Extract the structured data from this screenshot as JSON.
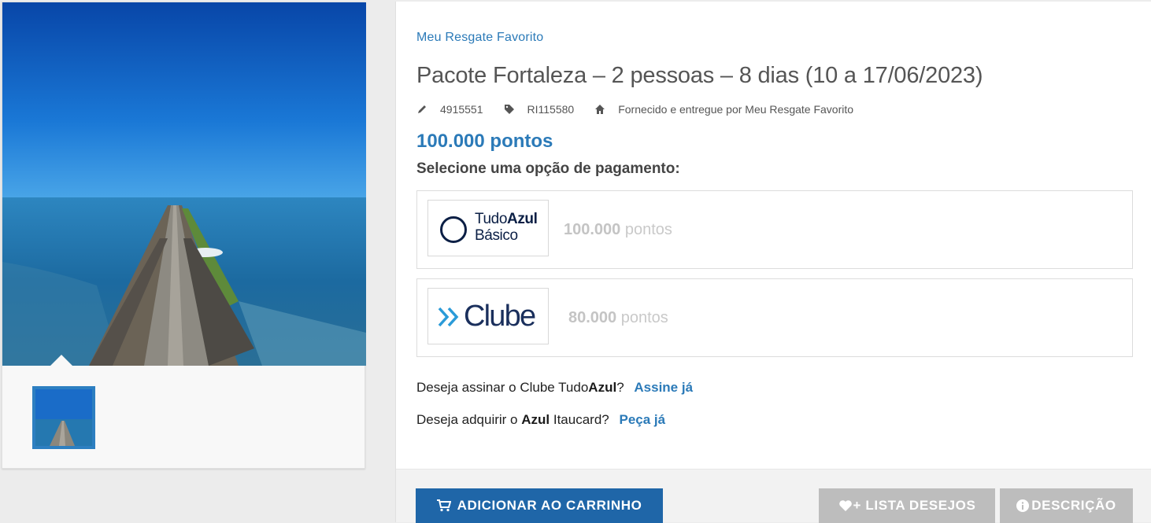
{
  "gallery": {
    "main_image": "fortaleza-pier-aerial-photo",
    "thumbnail": "fortaleza-pier-thumbnail"
  },
  "product": {
    "brand": "Meu Resgate Favorito",
    "title": "Pacote Fortaleza – 2 pessoas – 8 dias (10 a 17/06/2023)",
    "sku": "4915551",
    "ref": "RI115580",
    "supplier": "Fornecido e entregue por Meu Resgate Favorito",
    "price": "100.000 pontos"
  },
  "payment": {
    "label": "Selecione uma opção de pagamento:",
    "options": [
      {
        "logo_text_a": "Tudo",
        "logo_text_b": "Azul",
        "logo_text_c": "Básico",
        "points": "100.000",
        "unit": "pontos"
      },
      {
        "logo_text": "Clube",
        "points": "80.000",
        "unit": "pontos"
      }
    ]
  },
  "cta": {
    "clube_question_a": "Deseja assinar o Clube Tudo",
    "clube_question_b": "Azul",
    "clube_question_c": "?",
    "clube_link": "Assine já",
    "card_question_a": "Deseja adquirir o ",
    "card_question_b": "Azul",
    "card_question_c": " Itaucard?",
    "card_link": "Peça já"
  },
  "actions": {
    "cart": "ADICIONAR AO CARRINHO",
    "wishlist": "+ LISTA DESEJOS",
    "description": "DESCRIÇÃO"
  },
  "colors": {
    "accent": "#2b7ab8",
    "cart_button": "#1f66a8",
    "disabled_button": "#bdbdbd"
  }
}
